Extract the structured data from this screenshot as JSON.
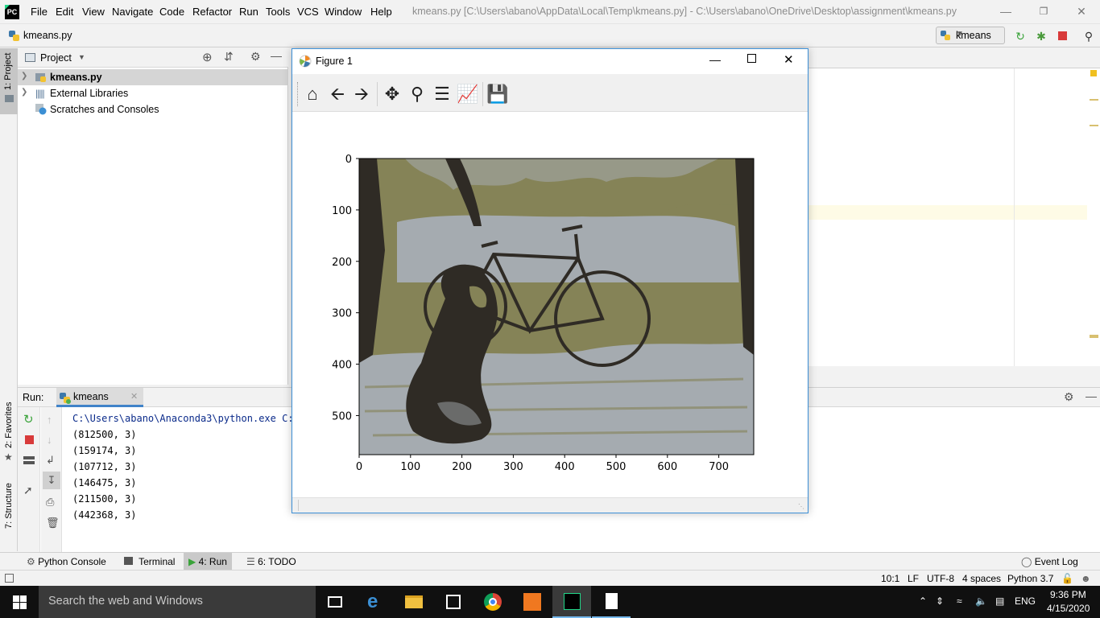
{
  "app": {
    "logo_text": "PC",
    "window_title": "kmeans.py [C:\\Users\\abano\\AppData\\Local\\Temp\\kmeans.py] - C:\\Users\\abano\\OneDrive\\Desktop\\assignment\\kmeans.py"
  },
  "menu": [
    "File",
    "Edit",
    "View",
    "Navigate",
    "Code",
    "Refactor",
    "Run",
    "Tools",
    "VCS",
    "Window",
    "Help"
  ],
  "navbar": {
    "breadcrumb_file": "kmeans.py",
    "run_config": "kmeans"
  },
  "stripe": {
    "project": "1: Project",
    "favorites": "2: Favorites",
    "structure": "7: Structure"
  },
  "project": {
    "title": "Project",
    "items": [
      "kmeans.py",
      "External Libraries",
      "Scratches and Consoles"
    ]
  },
  "run": {
    "label": "Run:",
    "tab": "kmeans",
    "command": "C:\\Users\\abano\\Anaconda3\\python.exe C:/",
    "output": [
      "(812500, 3)",
      "(159174, 3)",
      "(107712, 3)",
      "(146475, 3)",
      "(211500, 3)",
      "(442368, 3)"
    ]
  },
  "tooltabs": {
    "python_console": "Python Console",
    "terminal": "Terminal",
    "run": "4: Run",
    "todo": "6: TODO",
    "event_log": "Event Log"
  },
  "status": {
    "position": "10:1",
    "line_sep": "LF",
    "encoding": "UTF-8",
    "indent": "4 spaces",
    "interpreter": "Python 3.7"
  },
  "figure": {
    "title": "Figure 1",
    "toolbar_icons": [
      "home-icon",
      "back-arrow-icon",
      "forward-arrow-icon",
      "pan-icon",
      "zoom-icon",
      "subplots-icon",
      "edit-axes-icon",
      "save-icon"
    ],
    "colors": {
      "dark": "#2f2b25",
      "olive": "#858357",
      "light": "#a5abb0"
    }
  },
  "chart_data": {
    "type": "image",
    "title": "",
    "xlabel": "",
    "ylabel": "",
    "xticks": [
      0,
      100,
      200,
      300,
      400,
      500,
      600,
      700
    ],
    "yticks": [
      0,
      100,
      200,
      300,
      400,
      500
    ],
    "xlim": [
      0,
      768
    ],
    "ylim": [
      576,
      0
    ],
    "palette": [
      "#2f2b25",
      "#858357",
      "#a5abb0"
    ]
  },
  "taskbar": {
    "search_placeholder": "Search the web and Windows",
    "language": "ENG",
    "time": "9:36 PM",
    "date": "4/15/2020"
  }
}
